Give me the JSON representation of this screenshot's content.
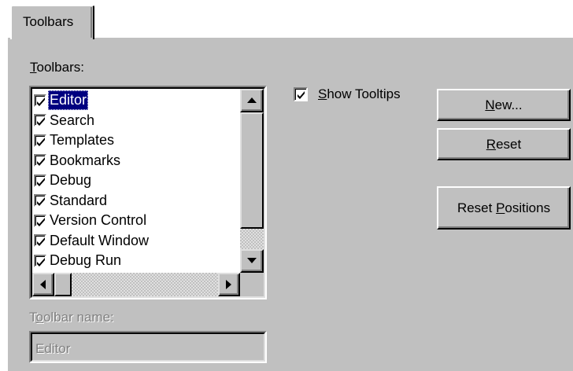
{
  "tab": {
    "label": "Toolbars"
  },
  "toolbars_label": {
    "underline": "T",
    "rest": "oolbars:"
  },
  "toolbars_list": [
    {
      "label": "Editor",
      "checked": true,
      "selected": true
    },
    {
      "label": "Search",
      "checked": true,
      "selected": false
    },
    {
      "label": "Templates",
      "checked": true,
      "selected": false
    },
    {
      "label": "Bookmarks",
      "checked": true,
      "selected": false
    },
    {
      "label": "Debug",
      "checked": true,
      "selected": false
    },
    {
      "label": "Standard",
      "checked": true,
      "selected": false
    },
    {
      "label": "Version Control",
      "checked": true,
      "selected": false
    },
    {
      "label": "Default Window",
      "checked": true,
      "selected": false
    },
    {
      "label": "Debug Run",
      "checked": true,
      "selected": false
    }
  ],
  "show_tooltips": {
    "underline": "S",
    "rest": "how Tooltips",
    "checked": true
  },
  "buttons": {
    "new": {
      "underline": "N",
      "rest": "ew..."
    },
    "reset": {
      "underline": "R",
      "rest": "eset"
    },
    "reset_positions": {
      "pre": "Reset ",
      "underline": "P",
      "rest": "ositions"
    }
  },
  "toolbar_name": {
    "label_pre": "T",
    "label_underline": "o",
    "label_rest": "olbar name:",
    "value": "Editor"
  }
}
